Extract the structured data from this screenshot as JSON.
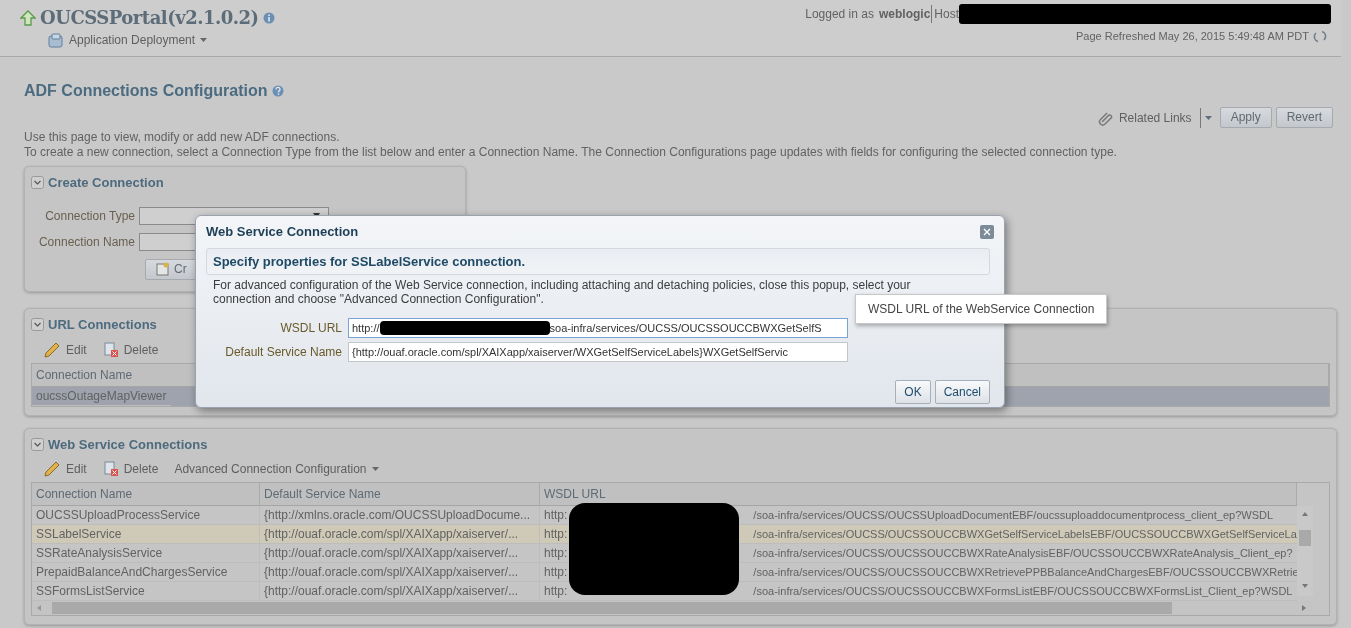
{
  "header": {
    "app_title": "OUCSSPortal(v2.1.0.2)",
    "menu": "Application Deployment",
    "logged_in_label": "Logged in as",
    "user": "weblogic",
    "host_label": "Host",
    "refreshed": "Page Refreshed May 26, 2015 5:49:48 AM PDT"
  },
  "page": {
    "title": "ADF Connections Configuration",
    "related_links": "Related Links",
    "buttons": [
      "Apply",
      "Revert"
    ],
    "description": [
      "Use this page to view, modify or add new ADF connections.",
      "To create a new connection, select a Connection Type from the list below and enter a Connection Name. The Connection Configurations page updates with fields for configuring the selected connection type."
    ]
  },
  "create_panel": {
    "title": "Create Connection",
    "expanded": true,
    "fields": [
      {
        "label": "Connection Type",
        "kind": "select"
      },
      {
        "label": "Connection Name",
        "kind": "text"
      }
    ],
    "button": "Cr"
  },
  "url_panel": {
    "title": "URL Connections",
    "expanded": true,
    "toolbar": [
      {
        "label": "Edit",
        "kind": "edit"
      },
      {
        "label": "Delete",
        "kind": "delete"
      }
    ],
    "columns": [
      "Connection Name"
    ],
    "rows": [
      {
        "cells": [
          "oucssOutageMapViewer"
        ],
        "selected": true
      }
    ]
  },
  "ws_panel": {
    "title": "Web Service Connections",
    "expanded": true,
    "toolbar": [
      {
        "label": "Edit",
        "kind": "edit"
      },
      {
        "label": "Delete",
        "kind": "delete"
      },
      {
        "label": "Advanced Connection Configuration",
        "kind": "menu"
      }
    ],
    "columns": [
      "Connection Name",
      "Default Service Name",
      "WSDL URL"
    ],
    "rows": [
      {
        "cells": [
          "OUCSSUploadProcessService",
          "{http://xmlns.oracle.com/OUCSSUploadDocume...",
          "http:",
          "/soa-infra/services/OUCSS/OUCSSUploadDocumentEBF/oucssuploaddocumentprocess_client_ep?WSDL"
        ],
        "selected": false
      },
      {
        "cells": [
          "SSLabelService",
          "{http://ouaf.oracle.com/spl/XAIXapp/xaiserver/...",
          "http:",
          "/soa-infra/services/OUCSS/OUCSSOUCCBWXGetSelfServiceLabelsEBF/OUCSSOUCCBWXGetSelfServiceLa"
        ],
        "selected": true
      },
      {
        "cells": [
          "SSRateAnalysisService",
          "{http://ouaf.oracle.com/spl/XAIXapp/xaiserver/...",
          "http:",
          "/soa-infra/services/OUCSS/OUCSSOUCCBWXRateAnalysisEBF/OUCSSOUCCBWXRateAnalysis_Client_ep?"
        ],
        "selected": false
      },
      {
        "cells": [
          "PrepaidBalanceAndChargesService",
          "{http://ouaf.oracle.com/spl/XAIXapp/xaiserver/...",
          "http:",
          "/soa-infra/services/OUCSS/OUCSSOUCCBWXRetrievePPBBalanceAndChargesEBF/OUCSSOUCCBWXRetrie"
        ],
        "selected": false
      },
      {
        "cells": [
          "SSFormsListService",
          "{http://ouaf.oracle.com/spl/XAIXapp/xaiserver/...",
          "http:",
          "/soa-infra/services/OUCSS/OUCSSOUCCBWXFormsListEBF/OUCSSOUCCBWXFormsList_Client_ep?WSDL"
        ],
        "selected": false
      }
    ]
  },
  "dialog": {
    "title": "Web Service Connection",
    "heading": "Specify properties for SSLabelService connection.",
    "text_lines": [
      "For advanced configuration of the Web Service connection, including attaching and detaching policies, close this popup, select your",
      "connection and choose \"Advanced Connection Configuration\"."
    ],
    "fields": [
      {
        "label": "WSDL URL",
        "value_start": "http://",
        "value_end": "soa-infra/services/OUCSS/OUCSSOUCCBWXGetSelfS",
        "focused": true
      },
      {
        "label": "Default Service Name",
        "value_start": "{http://ouaf.oracle.com/spl/XAIXapp/xaiserver/WXGetSelfServiceLabels}WXGetSelfServic",
        "focused": false
      }
    ],
    "buttons": [
      "OK",
      "Cancel"
    ]
  },
  "tooltip": "WSDL URL of the WebService Connection"
}
